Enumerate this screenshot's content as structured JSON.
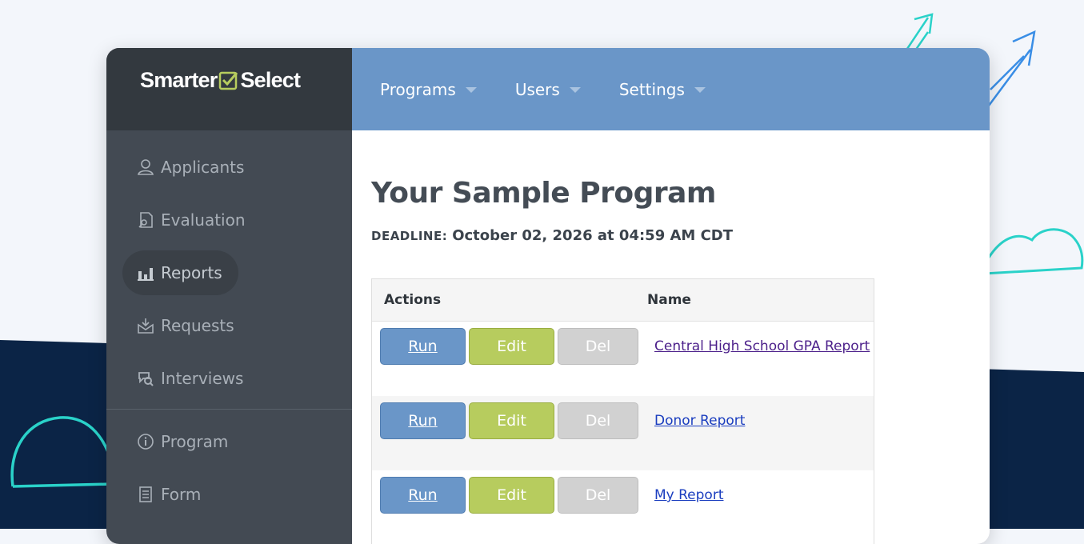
{
  "brand": {
    "name_left": "Smarter",
    "name_right": "Select"
  },
  "topnav": {
    "items": [
      {
        "label": "Programs"
      },
      {
        "label": "Users"
      },
      {
        "label": "Settings"
      }
    ]
  },
  "sidebar": {
    "items": [
      {
        "label": "Applicants",
        "icon": "user-icon"
      },
      {
        "label": "Evaluation",
        "icon": "evaluation-icon"
      },
      {
        "label": "Reports",
        "icon": "bar-chart-icon",
        "active": true
      },
      {
        "label": "Requests",
        "icon": "inbox-download-icon"
      },
      {
        "label": "Interviews",
        "icon": "interview-search-icon"
      },
      {
        "label": "Program",
        "icon": "info-icon"
      },
      {
        "label": "Form",
        "icon": "document-icon"
      }
    ]
  },
  "main": {
    "title": "Your Sample Program",
    "deadline_label": "DEADLINE:",
    "deadline_value": "October 02, 2026 at 04:59 AM CDT",
    "table": {
      "headers": [
        "Actions",
        "Name"
      ],
      "buttons": {
        "run": "Run",
        "edit": "Edit",
        "del": "Del"
      },
      "rows": [
        {
          "name": "Central High School GPA Report"
        },
        {
          "name": "Donor Report"
        },
        {
          "name": "My Report"
        }
      ]
    }
  },
  "colors": {
    "sidebar": "#434a53",
    "brand_bar": "#33393f",
    "topbar": "#6a96c8",
    "run_button": "#6a96c8",
    "edit_button": "#b7cc5e",
    "del_button": "#d1d1d1",
    "link": "#1a3dbf",
    "background_navy": "#0b2446",
    "accent_teal": "#2ad2c9",
    "accent_blue": "#3a8ee6"
  }
}
